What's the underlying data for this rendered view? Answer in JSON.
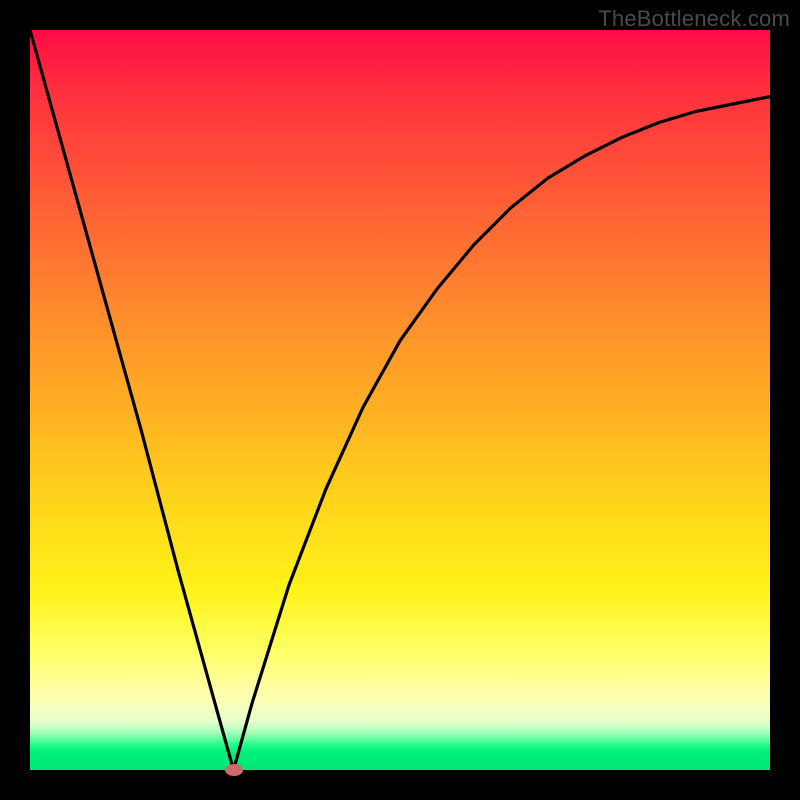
{
  "watermark": "TheBottleneck.com",
  "colors": {
    "page_bg": "#000000",
    "curve": "#000000",
    "marker": "#cf6a6a",
    "gradient_stops": [
      "#ff0b46",
      "#ff2f3e",
      "#ff5a36",
      "#ff8b2c",
      "#ffb222",
      "#ffd81a",
      "#fff31a",
      "#ffff66",
      "#ffffb0",
      "#e6ffcc",
      "#9fffb8",
      "#2bff8b",
      "#00f07a",
      "#00e676"
    ]
  },
  "chart_data": {
    "type": "line",
    "title": "",
    "xlabel": "",
    "ylabel": "",
    "xlim": [
      0,
      100
    ],
    "ylim": [
      0,
      100
    ],
    "grid": false,
    "legend": false,
    "series": [
      {
        "name": "bottleneck-curve",
        "x": [
          0,
          5,
          10,
          15,
          20,
          25,
          27.5,
          30,
          35,
          40,
          45,
          50,
          55,
          60,
          65,
          70,
          75,
          80,
          85,
          90,
          95,
          100
        ],
        "y": [
          100,
          82,
          64,
          46,
          27,
          9,
          0,
          9,
          25,
          38,
          49,
          58,
          65,
          71,
          76,
          80,
          83,
          85.5,
          87.5,
          89,
          90,
          91
        ]
      }
    ],
    "marker": {
      "x": 27.5,
      "y": 0,
      "name": "minimum"
    },
    "axis_ticks": {
      "x": [],
      "y": []
    },
    "annotations": []
  }
}
